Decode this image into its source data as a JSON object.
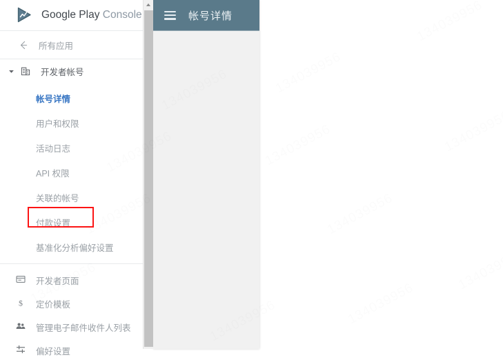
{
  "brand": {
    "logo_icon": "google-play-logo-icon",
    "name_bold": "Google Play",
    "name_light": "Console"
  },
  "sidebar": {
    "back": {
      "icon": "arrow-left-icon",
      "label": "所有应用"
    },
    "group": {
      "caret_icon": "caret-down-icon",
      "icon": "building-icon",
      "label": "开发者帐号"
    },
    "sub_items": [
      {
        "label": "帐号详情",
        "active": true
      },
      {
        "label": "用户和权限",
        "active": false
      },
      {
        "label": "活动日志",
        "active": false
      },
      {
        "label": "API 权限",
        "active": false
      },
      {
        "label": "关联的帐号",
        "active": false
      },
      {
        "label": "付款设置",
        "active": false,
        "highlighted": true
      },
      {
        "label": "基准化分析偏好设置",
        "active": false
      }
    ],
    "bottom_items": [
      {
        "icon": "window-icon",
        "label": "开发者页面"
      },
      {
        "icon": "dollar-icon",
        "label": "定价模板"
      },
      {
        "icon": "people-icon",
        "label": "管理电子邮件收件人列表"
      },
      {
        "icon": "tune-icon",
        "label": "偏好设置"
      }
    ]
  },
  "scrollbar": {
    "up_arrow_icon": "scroll-up-arrow-icon"
  },
  "panel": {
    "menu_icon": "hamburger-menu-icon",
    "title": "帐号详情"
  },
  "colors": {
    "header_bg": "#5a7a8a",
    "active_link": "#3b78c4",
    "highlight_border": "#fc1414",
    "panel_bg": "#f1f1f1",
    "muted_text": "#9aa0a6"
  },
  "watermarks": [
    "134039956",
    "134039956",
    "134039956",
    "134039956",
    "134039956",
    "134039956",
    "134039956",
    "134039956",
    "134039956",
    "134039956",
    "134039956",
    "134039956"
  ]
}
